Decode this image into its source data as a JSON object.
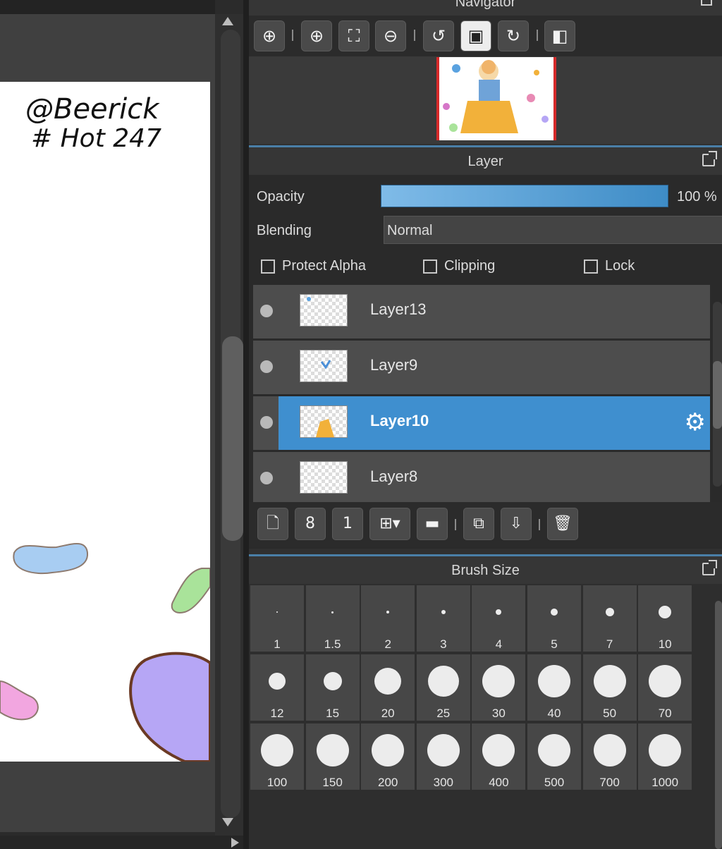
{
  "canvas": {
    "signature_lines": [
      "@Beerick",
      "# Hot 247"
    ]
  },
  "navigator": {
    "title": "Navigator",
    "toolbar": [
      {
        "name": "zoom-fit-icon",
        "glyph": "⊕"
      },
      {
        "name": "zoom-in-icon",
        "glyph": "⊕"
      },
      {
        "name": "fit-window-icon",
        "glyph": "⛶"
      },
      {
        "name": "zoom-out-icon",
        "glyph": "⊖"
      },
      {
        "name": "rotate-left-icon",
        "glyph": "↺"
      },
      {
        "name": "fit-canvas-icon",
        "glyph": "▣"
      },
      {
        "name": "rotate-right-icon",
        "glyph": "↻"
      },
      {
        "name": "flip-horizontal-icon",
        "glyph": "◧"
      }
    ]
  },
  "layer_panel": {
    "title": "Layer",
    "opacity_label": "Opacity",
    "opacity_value": "100 %",
    "opacity_level": 1.0,
    "blending_label": "Blending",
    "blending_value": "Normal",
    "checkboxes": {
      "protect_alpha": "Protect Alpha",
      "clipping": "Clipping",
      "lock": "Lock"
    },
    "layers": [
      {
        "name": "Layer13",
        "selected": false
      },
      {
        "name": "Layer9",
        "selected": false
      },
      {
        "name": "Layer10",
        "selected": true
      },
      {
        "name": "Layer8",
        "selected": false
      }
    ],
    "toolbar": [
      {
        "name": "new-layer-icon",
        "glyph": "🗋"
      },
      {
        "name": "new-8bit-layer-icon",
        "glyph": "8"
      },
      {
        "name": "new-1bit-layer-icon",
        "glyph": "1"
      },
      {
        "name": "add-special-layer-icon",
        "glyph": "⊞▾"
      },
      {
        "name": "new-folder-icon",
        "glyph": "▬"
      },
      {
        "name": "duplicate-layer-icon",
        "glyph": "⧉"
      },
      {
        "name": "merge-down-icon",
        "glyph": "⇩"
      },
      {
        "name": "delete-layer-icon",
        "glyph": "🗑"
      }
    ]
  },
  "brush_panel": {
    "title": "Brush Size",
    "sizes": [
      "1",
      "1.5",
      "2",
      "3",
      "4",
      "5",
      "7",
      "10",
      "12",
      "15",
      "20",
      "25",
      "30",
      "40",
      "50",
      "70",
      "100",
      "150",
      "200",
      "300",
      "400",
      "500",
      "700",
      "1000"
    ]
  },
  "colors": {
    "selection_blue": "#3f8fcf",
    "panel_accent": "#4a7fa8",
    "background": "#2b2b2b"
  }
}
